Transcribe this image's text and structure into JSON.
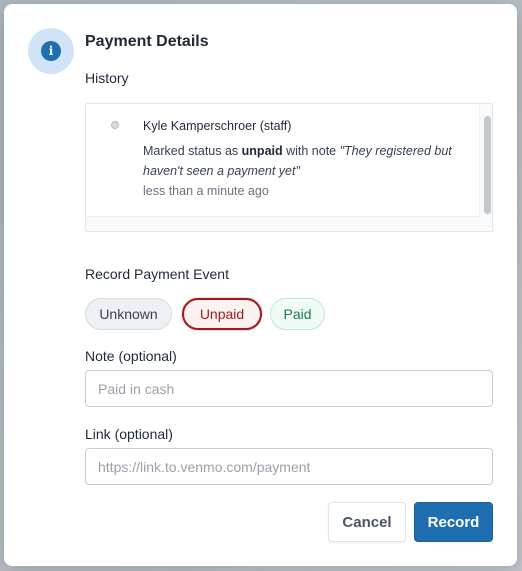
{
  "dialog": {
    "title": "Payment Details",
    "info_icon_glyph": "i"
  },
  "history": {
    "label": "History",
    "entries": [
      {
        "author": "Kyle Kamperschroer (staff)",
        "prefix": "Marked status as ",
        "status": "unpaid",
        "middle": " with note ",
        "note": "\"They registered but haven't seen a payment yet\"",
        "time": "less than a minute ago"
      }
    ]
  },
  "record": {
    "label": "Record Payment Event",
    "options": [
      {
        "label": "Unknown",
        "selected": false
      },
      {
        "label": "Unpaid",
        "selected": true
      },
      {
        "label": "Paid",
        "selected": false
      }
    ]
  },
  "note_field": {
    "label": "Note (optional)",
    "placeholder": "Paid in cash",
    "value": ""
  },
  "link_field": {
    "label": "Link (optional)",
    "placeholder": "https://link.to.venmo.com/payment",
    "value": ""
  },
  "actions": {
    "cancel_label": "Cancel",
    "record_label": "Record"
  },
  "colors": {
    "accent": "#1f6fb0",
    "unpaid": "#9b1c1c",
    "paid": "#1a7a4a"
  }
}
